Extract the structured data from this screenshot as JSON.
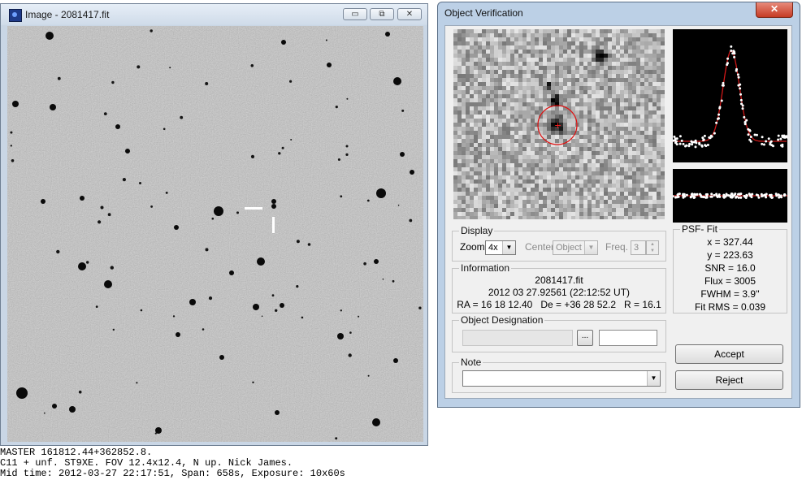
{
  "image_window": {
    "title": "Image - 2081417.fit",
    "minimize_symbol": "▭",
    "restore_symbol": "⧉",
    "close_symbol": "✕"
  },
  "caption": {
    "line1": "MASTER 161812.44+362852.8.",
    "line2": "C11 + unf. ST9XE. FOV 12.4x12.4, N up. Nick James.",
    "line3": "Mid time: 2012-03-27 22:17:51, Span: 658s, Exposure: 10x60s"
  },
  "verification": {
    "title": "Object Verification",
    "close_symbol": "✕",
    "display": {
      "group_label": "Display",
      "zoom_label": "Zoom",
      "zoom_value": "4x",
      "center_label": "Center",
      "center_value": "Object",
      "freq_label": "Freq.",
      "freq_value": "3"
    },
    "information": {
      "group_label": "Information",
      "filename": "2081417.fit",
      "date": "2012 03 27.92561 (22:12:52 UT)",
      "coords": "RA = 16 18 12.40   De = +36 28 52.2   R = 16.1"
    },
    "psf_fit": {
      "group_label": "PSF- Fit",
      "x": "x = 327.44",
      "y": "y = 223.63",
      "snr": "SNR = 16.0",
      "flux": "Flux = 3005",
      "fwhm": "FWHM = 3.9''",
      "rms": "Fit RMS = 0.039"
    },
    "designation": {
      "group_label": "Object Designation",
      "browse_symbol": "..."
    },
    "note": {
      "group_label": "Note"
    },
    "accept_label": "Accept",
    "reject_label": "Reject"
  }
}
